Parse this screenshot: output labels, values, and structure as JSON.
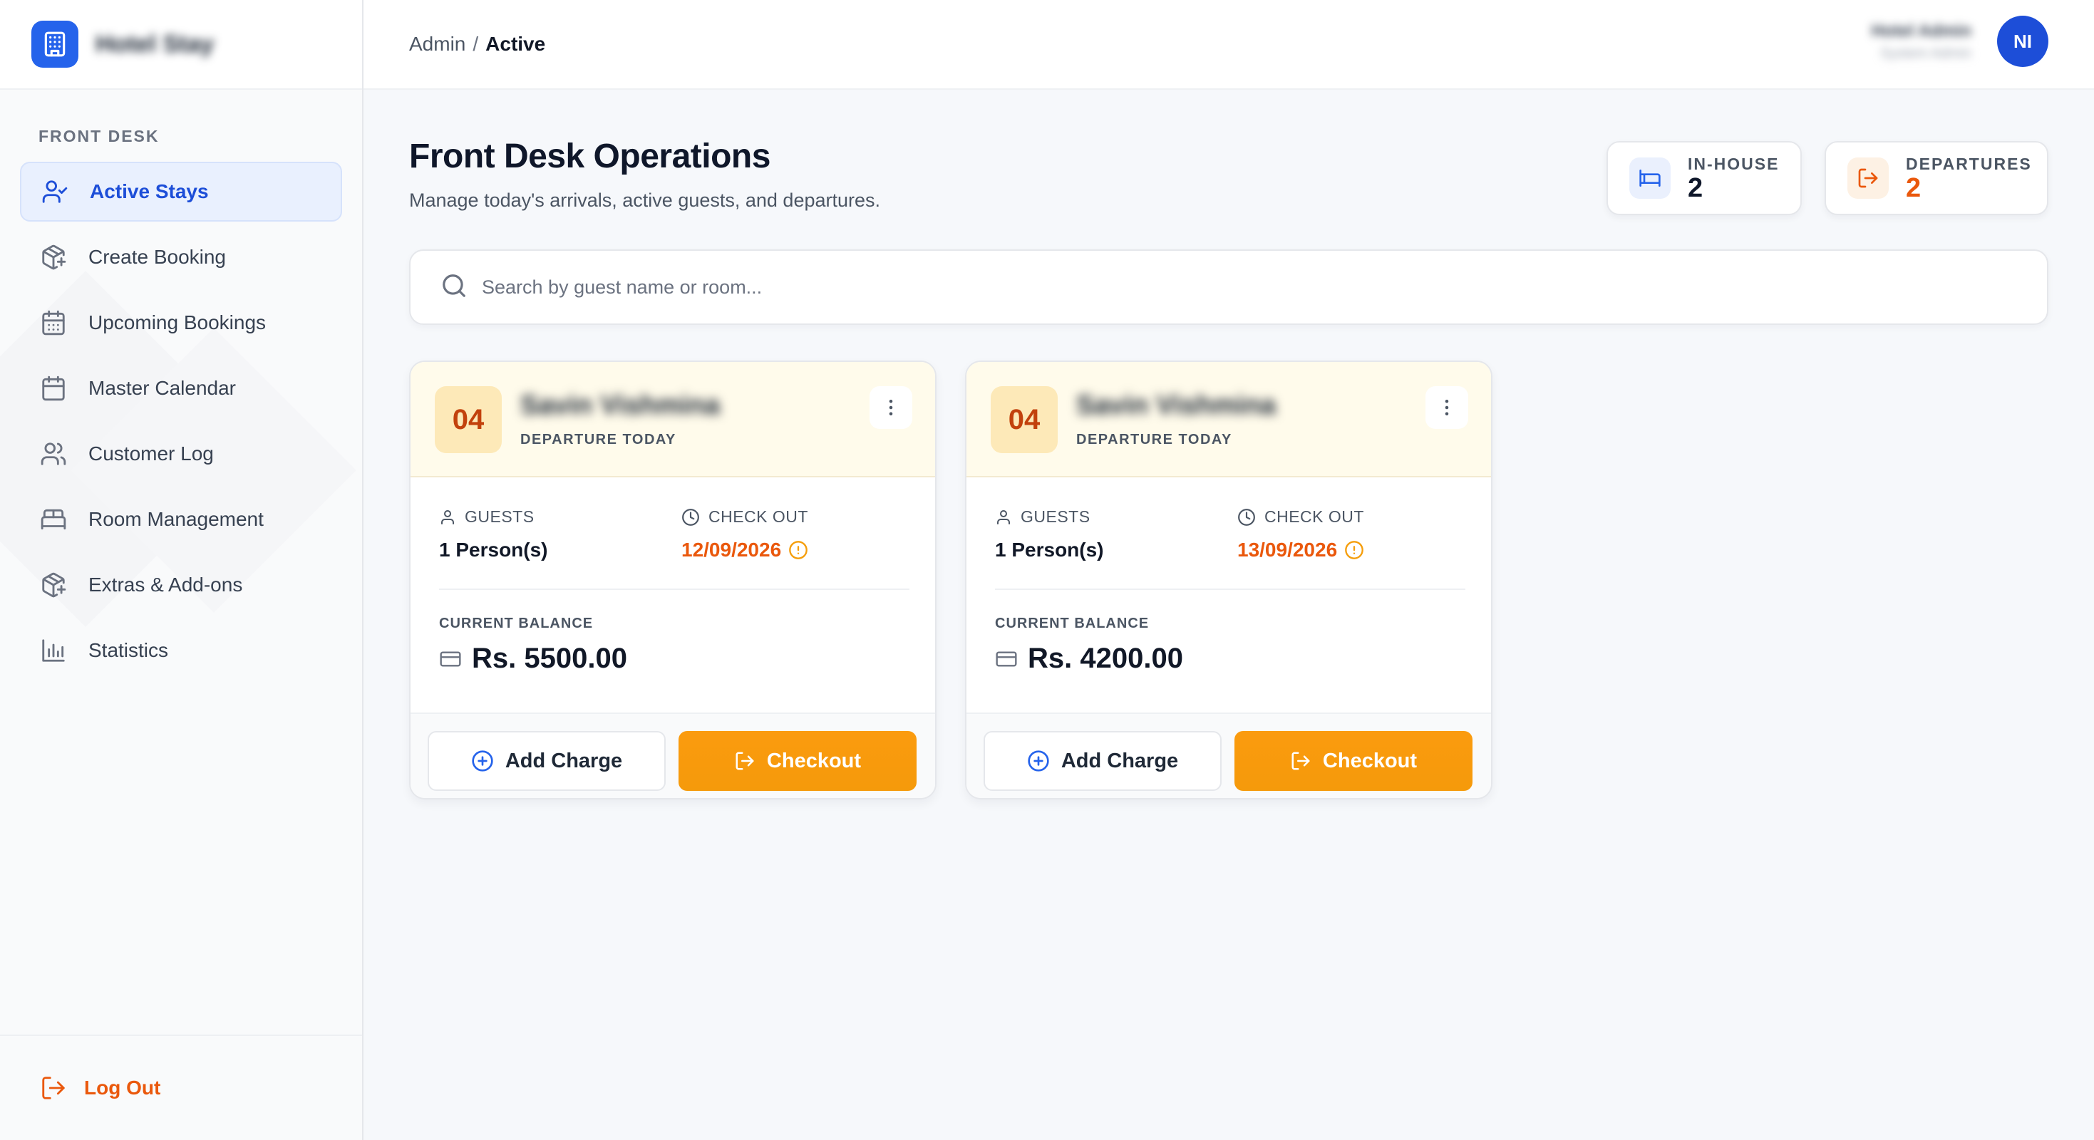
{
  "brand": {
    "name": "Hotel Stay"
  },
  "sidebar": {
    "section_label": "FRONT DESK",
    "items": [
      {
        "label": "Active Stays",
        "icon": "user-check-icon",
        "active": true
      },
      {
        "label": "Create Booking",
        "icon": "package-plus-icon"
      },
      {
        "label": "Upcoming Bookings",
        "icon": "calendar-days-icon"
      },
      {
        "label": "Master Calendar",
        "icon": "calendar-icon"
      },
      {
        "label": "Customer Log",
        "icon": "users-icon"
      },
      {
        "label": "Room Management",
        "icon": "bed-icon"
      },
      {
        "label": "Extras & Add-ons",
        "icon": "package-plus-icon"
      },
      {
        "label": "Statistics",
        "icon": "bar-chart-icon"
      }
    ],
    "logout_label": "Log Out"
  },
  "header": {
    "breadcrumb_root": "Admin",
    "breadcrumb_sep": "/",
    "breadcrumb_current": "Active",
    "user_name": "Hotel Admin",
    "user_role": "System Admin",
    "avatar_initials": "NI"
  },
  "page": {
    "title": "Front Desk Operations",
    "subtitle": "Manage today's arrivals, active guests, and departures."
  },
  "stats": {
    "in_house": {
      "label": "IN-HOUSE",
      "value": "2",
      "icon": "bed-icon"
    },
    "departures": {
      "label": "DEPARTURES",
      "value": "2",
      "icon": "log-out-icon"
    }
  },
  "search": {
    "placeholder": "Search by guest name or room..."
  },
  "stays": [
    {
      "room": "04",
      "guest_name": "Savin Vishmina",
      "status": "DEPARTURE TODAY",
      "guests_label": "GUESTS",
      "guests_value": "1 Person(s)",
      "checkout_label": "CHECK OUT",
      "checkout_value": "12/09/2026",
      "balance_label": "CURRENT BALANCE",
      "balance_value": "Rs. 5500.00",
      "add_charge_label": "Add Charge",
      "checkout_btn_label": "Checkout"
    },
    {
      "room": "04",
      "guest_name": "Savin Vishmina",
      "status": "DEPARTURE TODAY",
      "guests_label": "GUESTS",
      "guests_value": "1 Person(s)",
      "checkout_label": "CHECK OUT",
      "checkout_value": "13/09/2026",
      "balance_label": "CURRENT BALANCE",
      "balance_value": "Rs. 4200.00",
      "add_charge_label": "Add Charge",
      "checkout_btn_label": "Checkout"
    }
  ],
  "colors": {
    "primary": "#2563eb",
    "accent_orange": "#f59e0b",
    "warning_text": "#ea580c",
    "card_header_bg": "#fffbeb"
  }
}
